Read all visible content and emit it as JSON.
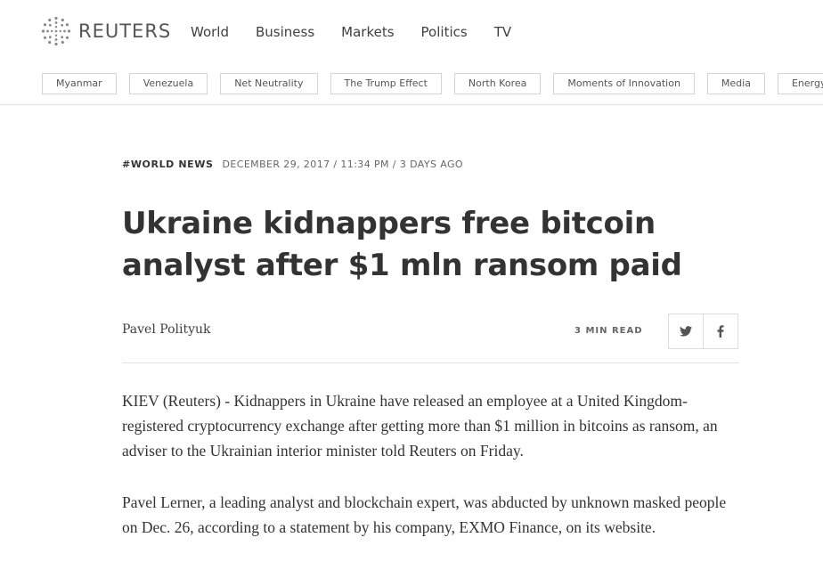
{
  "brand": {
    "name": "REUTERS",
    "logo_icon": "reuters-dot-globe-logo"
  },
  "main_nav": [
    "World",
    "Business",
    "Markets",
    "Politics",
    "TV"
  ],
  "tags": [
    "Myanmar",
    "Venezuela",
    "Net Neutrality",
    "The Trump Effect",
    "North Korea",
    "Moments of Innovation",
    "Media",
    "Energy & Environment"
  ],
  "article": {
    "section": "#WORLD NEWS",
    "dateline": "DECEMBER 29, 2017 / 11:34 PM / 3 DAYS AGO",
    "headline": "Ukraine kidnappers free bitcoin analyst after $1 mln ransom paid",
    "author": "Pavel Polityuk",
    "read_time": "3 MIN READ",
    "share": {
      "twitter_icon": "twitter-icon",
      "facebook_icon": "facebook-icon"
    },
    "paragraphs": [
      "KIEV (Reuters) - Kidnappers in Ukraine have released an employee at a United Kingdom-registered cryptocurrency exchange after getting more than $1 million in bitcoins as ransom, an adviser to the Ukrainian interior minister told Reuters on Friday.",
      "Pavel Lerner, a leading analyst and blockchain expert, was abducted by unknown masked people on Dec. 26, according to a statement by his company, EXMO Finance, on its website."
    ]
  },
  "colors": {
    "text": "#333333",
    "muted": "#666666",
    "border": "#e2e2e2",
    "logo": "#9a9a9a"
  }
}
